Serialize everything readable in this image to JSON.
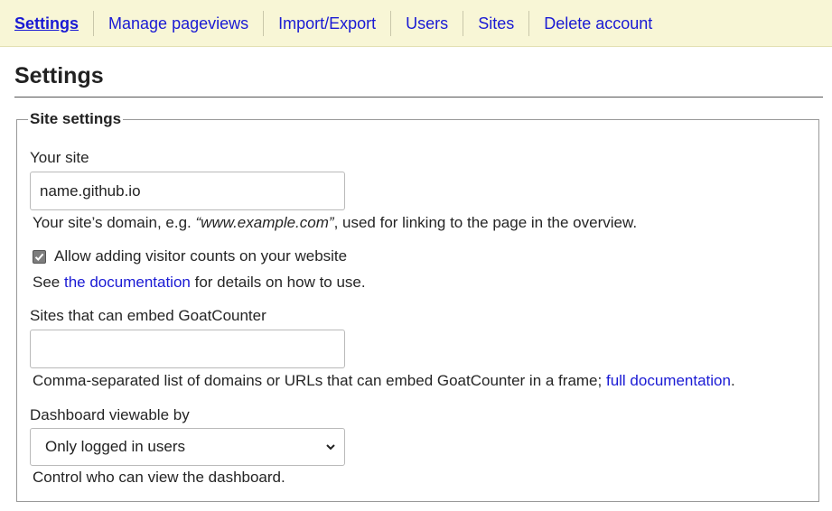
{
  "nav": {
    "items": [
      {
        "label": "Settings"
      },
      {
        "label": "Manage pageviews"
      },
      {
        "label": "Import/Export"
      },
      {
        "label": "Users"
      },
      {
        "label": "Sites"
      },
      {
        "label": "Delete account"
      }
    ]
  },
  "page": {
    "title": "Settings"
  },
  "site_settings": {
    "legend": "Site settings",
    "your_site": {
      "label": "Your site",
      "value": "name.github.io",
      "help_prefix": "Your site’s domain, e.g. ",
      "help_example": "“www.example.com”",
      "help_suffix": ", used for linking to the page in the overview."
    },
    "visitor_counts": {
      "checked": true,
      "label": "Allow adding visitor counts on your website",
      "help_prefix": "See ",
      "help_link": "the documentation",
      "help_suffix": " for details on how to use."
    },
    "embed": {
      "label": "Sites that can embed GoatCounter",
      "value": "",
      "help_prefix": "Comma-separated list of domains or URLs that can embed GoatCounter in a frame; ",
      "help_link": "full documentation",
      "help_suffix": "."
    },
    "dashboard": {
      "label": "Dashboard viewable by",
      "selected": "Only logged in users",
      "help": "Control who can view the dashboard."
    }
  },
  "colors": {
    "link": "#1a1ad4",
    "nav_bg": "#f8f6d6",
    "checkbox": "#7d7d7d"
  }
}
